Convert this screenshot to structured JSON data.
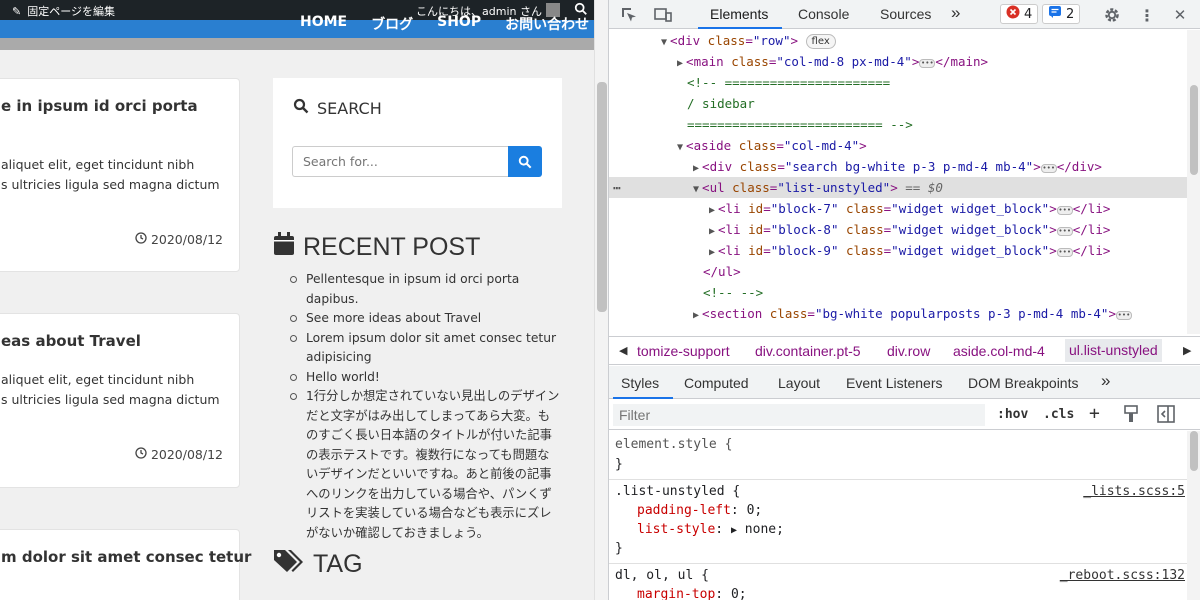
{
  "site": {
    "adminbar": {
      "edit_label": "固定ページを編集",
      "greeting": "こんにちは、admin さん"
    },
    "nav": [
      "HOME",
      "ブログ",
      "SHOP",
      "お問い合わせ"
    ],
    "cards": [
      {
        "title": "e in ipsum id orci porta",
        "line1": "aliquet elit, eget tincidunt nibh",
        "line2": "s ultricies ligula sed magna dictum",
        "date": "2020/08/12"
      },
      {
        "title": "eas about Travel",
        "line1": "aliquet elit, eget tincidunt nibh",
        "line2": "s ultricies ligula sed magna dictum",
        "date": "2020/08/12"
      },
      {
        "title": "m dolor sit amet consec tetur"
      }
    ],
    "search": {
      "title": "SEARCH",
      "placeholder": "Search for..."
    },
    "recent": {
      "title": "RECENT POST",
      "items": [
        "Pellentesque in ipsum id orci porta dapibus.",
        "See more ideas about Travel",
        "Lorem ipsum dolor sit amet consec tetur adipisicing",
        "Hello world!",
        "1行分しか想定されていない見出しのデザインだと文字がはみ出してしまってあら大変。ものすごく長い日本語のタイトルが付いた記事の表示テストです。複数行になっても問題ないデザインだといいですね。あと前後の記事へのリンクを出力している場合や、パンくずリストを実装している場合なども表示にズレがないか確認しておきましょう。"
      ]
    },
    "tag": {
      "title": "TAG"
    }
  },
  "devtools": {
    "tabs": [
      "Elements",
      "Console",
      "Sources"
    ],
    "more": "»",
    "errors": "4",
    "messages": "2",
    "dom": {
      "l1_tag": "div",
      "l1_attr": "class",
      "l1_val": "\"row\"",
      "l1_pill": "flex",
      "l2_tag": "main",
      "l2_attr": "class",
      "l2_val": "\"col-md-8 px-md-4\"",
      "c1": "<!-- ======================",
      "c2": "/  sidebar",
      "c3": "========================== -->",
      "l3_tag": "aside",
      "l3_attr": "class",
      "l3_val": "\"col-md-4\"",
      "l4_tag": "div",
      "l4_attr": "class",
      "l4_val": "\"search bg-white p-3 p-md-4 mb-4\"",
      "l5_tag": "ul",
      "l5_attr": "class",
      "l5_val": "\"list-unstyled\"",
      "l5_eq": " == $0",
      "li1_id": "\"block-7\"",
      "li2_id": "\"block-8\"",
      "li3_id": "\"block-9\"",
      "li_class": "\"widget widget_block\"",
      "ul_close": "</ul>",
      "c4": "<!-- -->",
      "l6_tag": "section",
      "l6_attr": "class",
      "l6_val": "\"bg-white popularposts p-3 p-md-4 mb-4\""
    },
    "breadcrumbs": [
      "tomize-support",
      "div.container.pt-5",
      "div.row",
      "aside.col-md-4",
      "ul.list-unstyled"
    ],
    "styles_tabs": [
      "Styles",
      "Computed",
      "Layout",
      "Event Listeners",
      "DOM Breakpoints"
    ],
    "filter_placeholder": "Filter",
    "hov": ":hov",
    "cls": ".cls",
    "rules": {
      "r1_sel": "element.style {",
      "r1_close": "}",
      "r2_sel": ".list-unstyled {",
      "r2_src": "_lists.scss:5",
      "r2_p1": "padding-left",
      "r2_v1": "0;",
      "r2_p2": "list-style",
      "r2_v2": "none;",
      "r2_close": "}",
      "r3_sel": "dl, ol, ul {",
      "r3_src": "_reboot.scss:132",
      "r3_p1": "margin-top",
      "r3_v1": "0;"
    }
  }
}
